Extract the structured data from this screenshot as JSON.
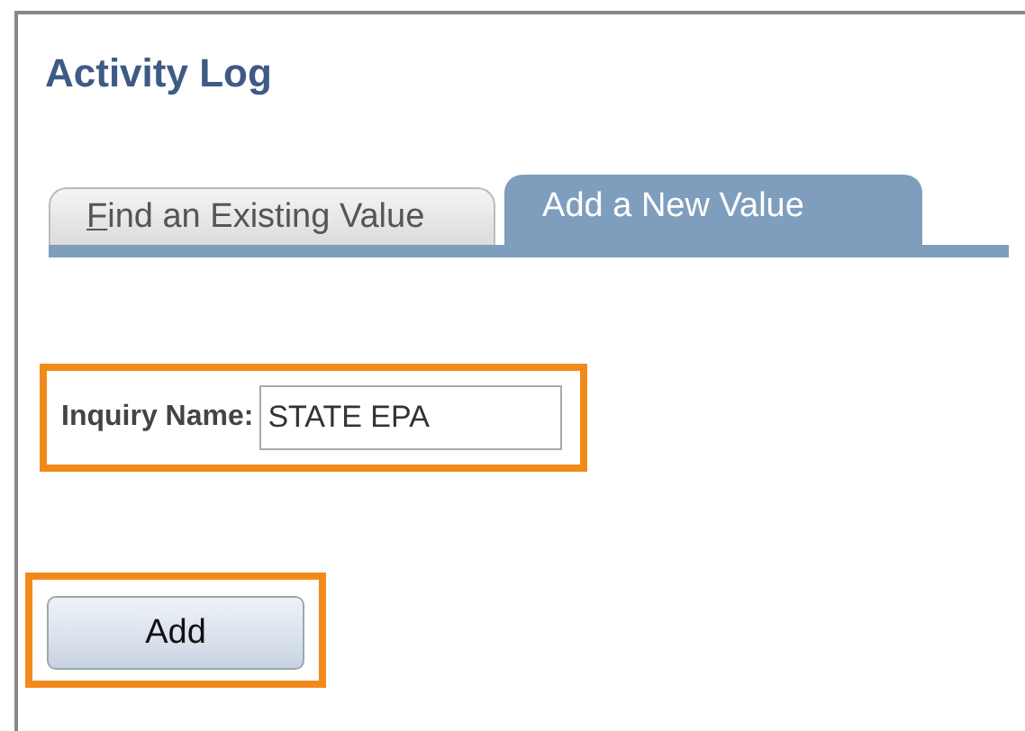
{
  "page": {
    "title": "Activity Log"
  },
  "tabs": [
    {
      "label": "Find an Existing Value",
      "selected": false
    },
    {
      "label": "Add a New Value",
      "selected": true
    }
  ],
  "field": {
    "label": "Inquiry Name:",
    "value": "STATE EPA",
    "highlighted": true
  },
  "button": {
    "label": "Add",
    "highlighted": true
  }
}
